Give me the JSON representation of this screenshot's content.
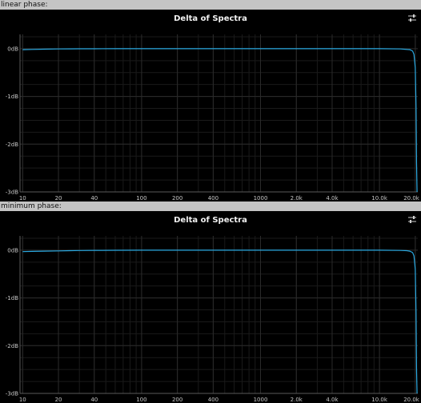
{
  "sections": [
    {
      "label": "linear phase:",
      "chart_data": {
        "type": "line",
        "title": "Delta of Spectra",
        "xscale": "log",
        "xlim": [
          9.5,
          21000
        ],
        "ylim": [
          -3,
          0.3
        ],
        "y_ticks": [
          0,
          -1,
          -2,
          -3
        ],
        "y_tick_labels": [
          "0dB",
          "-1dB",
          "-2dB",
          "-3dB"
        ],
        "x_ticks": [
          10,
          20,
          40,
          100,
          200,
          400,
          1000,
          2000,
          4000,
          10000,
          20000
        ],
        "x_tick_labels": [
          "10",
          "20",
          "40",
          "100",
          "200",
          "400",
          "1000",
          "2.0k",
          "4.0k",
          "10.0k",
          "20.0k"
        ],
        "grid": true,
        "series": [
          {
            "color": "#29a8e0",
            "x": [
              10,
              12,
              15,
              20,
              25,
              30,
              40,
              60,
              100,
              200,
              300,
              500,
              1000,
              2000,
              5000,
              10000,
              15000,
              18000,
              19000,
              19500,
              20000,
              20300,
              20500,
              20700
            ],
            "y": [
              -0.02,
              -0.015,
              -0.01,
              -0.005,
              -0.003,
              -0.002,
              -0.001,
              0,
              0,
              0,
              0,
              0,
              0,
              0,
              0,
              0,
              -0.005,
              -0.02,
              -0.05,
              -0.12,
              -0.4,
              -1.2,
              -2.4,
              -3.0
            ]
          }
        ]
      }
    },
    {
      "label": "minimum phase:",
      "chart_data": {
        "type": "line",
        "title": "Delta of Spectra",
        "xscale": "log",
        "xlim": [
          9.5,
          21000
        ],
        "ylim": [
          -3,
          0.3
        ],
        "y_ticks": [
          0,
          -1,
          -2,
          -3
        ],
        "y_tick_labels": [
          "0dB",
          "-1dB",
          "-2dB",
          "-3dB"
        ],
        "x_ticks": [
          10,
          20,
          40,
          100,
          200,
          400,
          1000,
          2000,
          4000,
          10000,
          20000
        ],
        "x_tick_labels": [
          "10",
          "20",
          "40",
          "100",
          "200",
          "400",
          "1000",
          "2.0k",
          "4.0k",
          "10.0k",
          "20.0k"
        ],
        "grid": true,
        "series": [
          {
            "color": "#29a8e0",
            "x": [
              10,
              12,
              15,
              20,
              25,
              30,
              40,
              60,
              100,
              200,
              300,
              500,
              1000,
              2000,
              5000,
              10000,
              15000,
              17000,
              18000,
              19000,
              19500,
              20000,
              20300,
              20500,
              20700
            ],
            "y": [
              -0.03,
              -0.025,
              -0.02,
              -0.015,
              -0.01,
              -0.007,
              -0.004,
              -0.002,
              0,
              0,
              0,
              0,
              0,
              0,
              0,
              0,
              -0.005,
              -0.01,
              -0.02,
              -0.05,
              -0.12,
              -0.4,
              -1.3,
              -2.5,
              -3.0
            ]
          }
        ]
      }
    }
  ],
  "colors": {
    "page_bg": "#c4c4c4",
    "plot_bg": "#000000",
    "grid": "#2b2b2b",
    "grid_minor": "#1a1a1a",
    "axis": "#5a5a5a",
    "tick_text": "#c8c8c8",
    "title_text": "#f2f2f2"
  },
  "icons": {
    "settings": "settings-sliders-icon"
  }
}
